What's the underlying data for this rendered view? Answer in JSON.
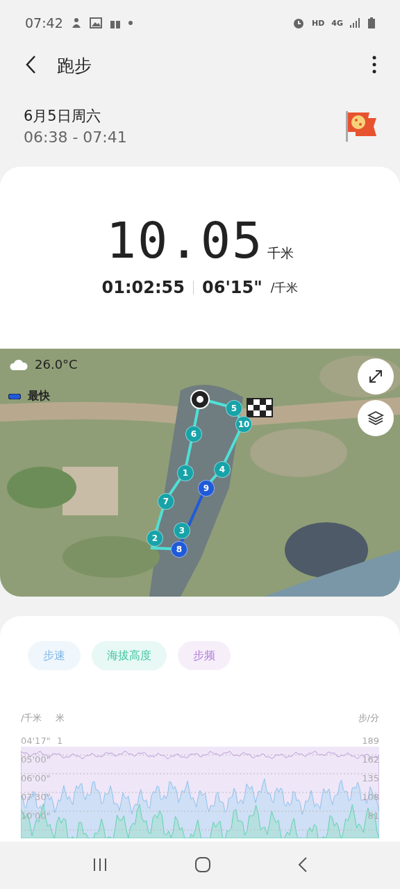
{
  "status_bar": {
    "time": "07:42",
    "network": "4G",
    "hd": "HD"
  },
  "header": {
    "title": "跑步"
  },
  "session": {
    "date": "6月5日周六",
    "time_range": "06:38 - 07:41"
  },
  "summary": {
    "distance": "10.05",
    "distance_unit": "千米",
    "duration": "01:02:55",
    "pace": "06'15\"",
    "pace_unit": "/千米"
  },
  "map": {
    "kind": "picture",
    "weather": "26.0°C",
    "legend": "最快",
    "markers": [
      {
        "label": "1",
        "fastest": false
      },
      {
        "label": "2",
        "fastest": false
      },
      {
        "label": "3",
        "fastest": false
      },
      {
        "label": "4",
        "fastest": false
      },
      {
        "label": "5",
        "fastest": false
      },
      {
        "label": "6",
        "fastest": false
      },
      {
        "label": "7",
        "fastest": false
      },
      {
        "label": "8",
        "fastest": true
      },
      {
        "label": "9",
        "fastest": true
      },
      {
        "label": "10",
        "fastest": false
      }
    ]
  },
  "metric_tabs": [
    {
      "label": "步速",
      "color": "#7ab6e8"
    },
    {
      "label": "海拔高度",
      "color": "#3fc7a2"
    },
    {
      "label": "步频",
      "color": "#b37ad9"
    }
  ],
  "chart": {
    "left_unit": "/千米",
    "mid_unit": "米",
    "right_unit": "步/分",
    "rows": [
      {
        "pace": "04'17\"",
        "alt": "1",
        "cadence": "189"
      },
      {
        "pace": "05'00\"",
        "cadence": "162"
      },
      {
        "pace": "06'00\"",
        "cadence": "135"
      },
      {
        "pace": "07'30\"",
        "cadence": "108"
      },
      {
        "pace": "10'00\"",
        "cadence": "81"
      }
    ]
  }
}
